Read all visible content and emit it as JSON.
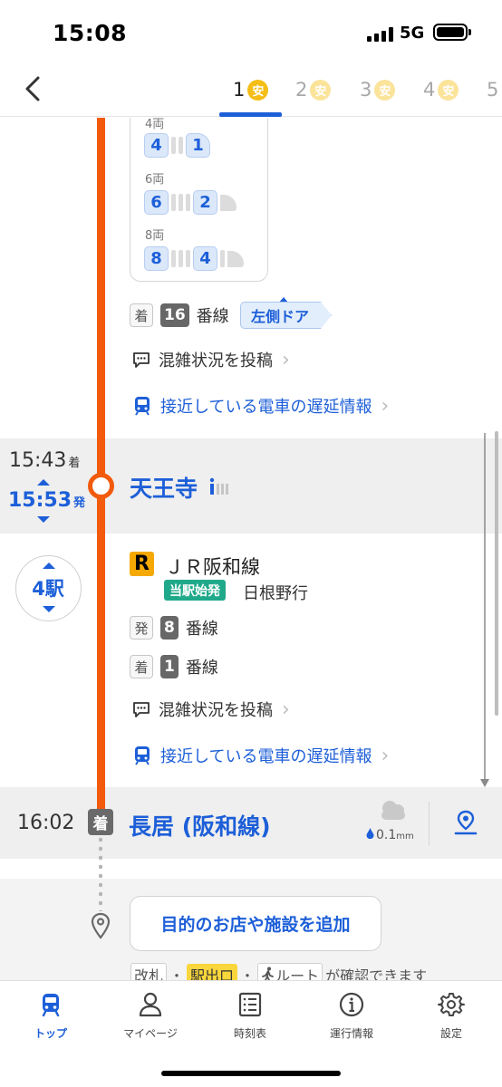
{
  "status_bar": {
    "time": "15:08",
    "network": "5G"
  },
  "route_tabs": [
    {
      "num": "1",
      "badge": "安",
      "active": true
    },
    {
      "num": "2",
      "badge": "安"
    },
    {
      "num": "3",
      "badge": "安"
    },
    {
      "num": "4",
      "badge": "安"
    },
    {
      "num": "5"
    }
  ],
  "car_position": {
    "rows": [
      {
        "label": "4両",
        "front": "4",
        "rear": "1"
      },
      {
        "label": "6両",
        "front": "6",
        "rear": "2"
      },
      {
        "label": "8両",
        "front": "8",
        "rear": "4"
      }
    ]
  },
  "leg1": {
    "arrive_tag": "着",
    "platform": "16",
    "platform_suffix": "番線",
    "door": "左側ドア",
    "congestion_link": "混雑状況を投稿",
    "delay_link": "接近している電車の遅延情報"
  },
  "transfer": {
    "arrive_time": "15:43",
    "arrive_suffix": "着",
    "depart_time": "15:53",
    "depart_suffix": "発",
    "station": "天王寺"
  },
  "leg2": {
    "stops": "4駅",
    "line_badge": "R",
    "line_name": "ＪＲ阪和線",
    "start_tag": "当駅始発",
    "destination": "日根野行",
    "depart_tag": "発",
    "depart_platform": "8",
    "arrive_tag": "着",
    "arrive_platform": "1",
    "platform_suffix": "番線",
    "congestion_link": "混雑状況を投稿",
    "delay_link": "接近している電車の遅延情報"
  },
  "destination": {
    "time": "16:02",
    "tag": "着",
    "station": "長居 (阪和線)",
    "rain": "0.1",
    "rain_unit": "mm"
  },
  "add_place": {
    "button": "目的のお店や施設を追加",
    "hint_gate": "改札",
    "hint_sep1": "・",
    "hint_exit": "駅出口",
    "hint_sep2": "・",
    "hint_route": "ルート",
    "hint_tail": "が確認できます"
  },
  "bottom_nav": [
    {
      "label": "トップ",
      "icon": "train-icon",
      "active": true
    },
    {
      "label": "マイページ",
      "icon": "person-icon"
    },
    {
      "label": "時刻表",
      "icon": "timetable-icon"
    },
    {
      "label": "運行情報",
      "icon": "info-icon"
    },
    {
      "label": "設定",
      "icon": "gear-icon"
    }
  ],
  "colors": {
    "accent": "#1d5fd8",
    "line": "#f25a0c",
    "safe": "#f5bd16",
    "start": "#1fa98a",
    "jr_badge": "#f5a800"
  }
}
